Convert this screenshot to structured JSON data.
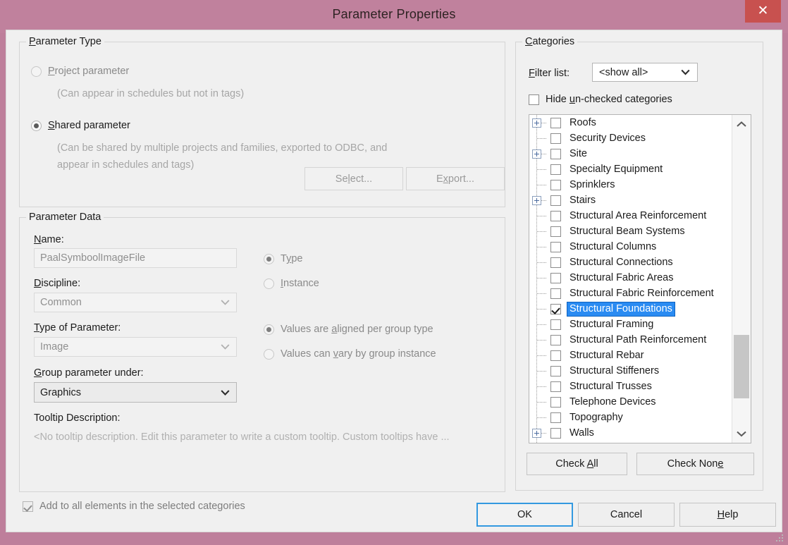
{
  "window": {
    "title": "Parameter Properties",
    "close_label": "✕"
  },
  "parameter_type": {
    "legend": "Parameter Type",
    "options": [
      {
        "label": "Project parameter",
        "mnemonic": "P",
        "selected": false,
        "enabled": false,
        "hint": "(Can appear in schedules but not in tags)"
      },
      {
        "label": "Shared parameter",
        "mnemonic": "S",
        "selected": true,
        "enabled": true,
        "hint_line1": "(Can be shared by multiple projects and families, exported to ODBC, and",
        "hint_line2": "appear in schedules and tags)"
      }
    ],
    "select_button": "Select...",
    "export_button": "Export..."
  },
  "parameter_data": {
    "legend": "Parameter Data",
    "name_label": "Name:",
    "name_value": "PaalSymboolImageFile",
    "discipline_label": "Discipline:",
    "discipline_value": "Common",
    "type_of_parameter_label": "Type of Parameter:",
    "type_of_parameter_value": "Image",
    "group_under_label": "Group parameter under:",
    "group_under_value": "Graphics",
    "tooltip_label": "Tooltip Description:",
    "tooltip_value": "<No tooltip description. Edit this parameter to write a custom tooltip. Custom tooltips have ...",
    "binding_options": [
      {
        "label": "Type",
        "selected": true
      },
      {
        "label": "Instance",
        "selected": false
      }
    ],
    "group_behaviour_options": [
      {
        "label": "Values are aligned per group type",
        "selected": true
      },
      {
        "label": "Values can vary by group instance",
        "selected": false
      }
    ]
  },
  "categories": {
    "legend": "Categories",
    "filter_label": "Filter list:",
    "filter_value": "<show all>",
    "hide_unchecked_label": "Hide un-checked categories",
    "hide_unchecked_value": false,
    "check_all_button": "Check All",
    "check_none_button": "Check None",
    "items": [
      {
        "label": "Roofs",
        "checked": false,
        "expandable": true,
        "selected": false
      },
      {
        "label": "Security Devices",
        "checked": false,
        "expandable": false,
        "selected": false
      },
      {
        "label": "Site",
        "checked": false,
        "expandable": true,
        "selected": false
      },
      {
        "label": "Specialty Equipment",
        "checked": false,
        "expandable": false,
        "selected": false
      },
      {
        "label": "Sprinklers",
        "checked": false,
        "expandable": false,
        "selected": false
      },
      {
        "label": "Stairs",
        "checked": false,
        "expandable": true,
        "selected": false
      },
      {
        "label": "Structural Area Reinforcement",
        "checked": false,
        "expandable": false,
        "selected": false
      },
      {
        "label": "Structural Beam Systems",
        "checked": false,
        "expandable": false,
        "selected": false
      },
      {
        "label": "Structural Columns",
        "checked": false,
        "expandable": false,
        "selected": false
      },
      {
        "label": "Structural Connections",
        "checked": false,
        "expandable": false,
        "selected": false
      },
      {
        "label": "Structural Fabric Areas",
        "checked": false,
        "expandable": false,
        "selected": false
      },
      {
        "label": "Structural Fabric Reinforcement",
        "checked": false,
        "expandable": false,
        "selected": false
      },
      {
        "label": "Structural Foundations",
        "checked": true,
        "expandable": false,
        "selected": true
      },
      {
        "label": "Structural Framing",
        "checked": false,
        "expandable": false,
        "selected": false
      },
      {
        "label": "Structural Path Reinforcement",
        "checked": false,
        "expandable": false,
        "selected": false
      },
      {
        "label": "Structural Rebar",
        "checked": false,
        "expandable": false,
        "selected": false
      },
      {
        "label": "Structural Stiffeners",
        "checked": false,
        "expandable": false,
        "selected": false
      },
      {
        "label": "Structural Trusses",
        "checked": false,
        "expandable": false,
        "selected": false
      },
      {
        "label": "Telephone Devices",
        "checked": false,
        "expandable": false,
        "selected": false
      },
      {
        "label": "Topography",
        "checked": false,
        "expandable": false,
        "selected": false
      },
      {
        "label": "Walls",
        "checked": false,
        "expandable": true,
        "selected": false
      },
      {
        "label": "",
        "checked": false,
        "expandable": false,
        "selected": false
      }
    ]
  },
  "footer": {
    "add_to_all_label": "Add to all elements in the selected categories",
    "add_to_all_checked": true,
    "ok_button": "OK",
    "cancel_button": "Cancel",
    "help_button": "Help"
  },
  "colors": {
    "titlebar": "#c0819d",
    "close_button": "#c8514f",
    "selection": "#2a8bf2",
    "focus_border": "#3399e0",
    "dialog_bg": "#f0f0f0"
  }
}
